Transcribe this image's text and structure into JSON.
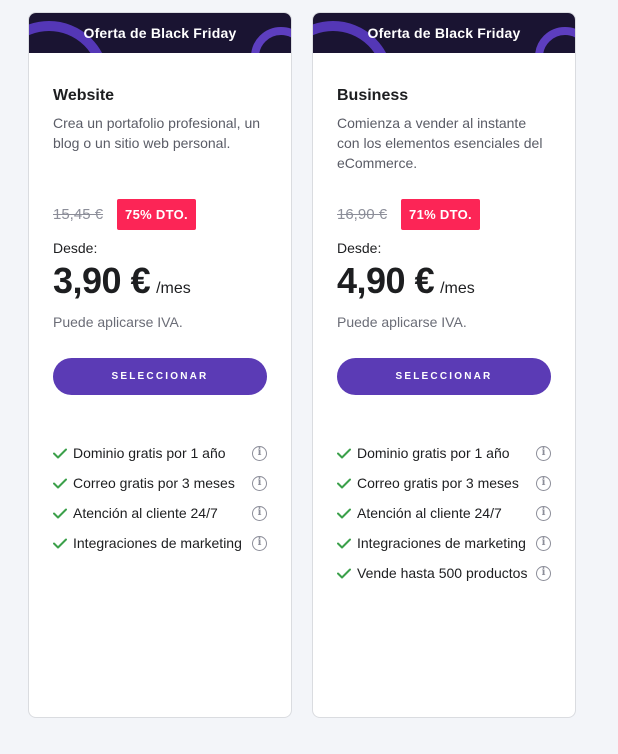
{
  "colors": {
    "accent": "#5b3bb5",
    "discount": "#fc2556",
    "banner_bg": "#1a1432",
    "check": "#3ca04b"
  },
  "plans": [
    {
      "banner": "Oferta de Black Friday",
      "name": "Website",
      "description": "Crea un portafolio profesional, un blog o un sitio web personal.",
      "old_price": "15,45 €",
      "discount": "75% DTO.",
      "from_label": "Desde:",
      "price": "3,90 €",
      "period": "/mes",
      "vat_note": "Puede aplicarse IVA.",
      "button": "SELECCIONAR",
      "features": [
        "Dominio gratis por 1 año",
        "Correo gratis por 3 meses",
        "Atención al cliente 24/7",
        "Integraciones de marketing"
      ]
    },
    {
      "banner": "Oferta de Black Friday",
      "name": "Business",
      "description": "Comienza a vender al instante con los elementos esenciales del eCommerce.",
      "old_price": "16,90 €",
      "discount": "71% DTO.",
      "from_label": "Desde:",
      "price": "4,90 €",
      "period": "/mes",
      "vat_note": "Puede aplicarse IVA.",
      "button": "SELECCIONAR",
      "features": [
        "Dominio gratis por 1 año",
        "Correo gratis por 3 meses",
        "Atención al cliente 24/7",
        "Integraciones de marketing",
        "Vende hasta 500 productos"
      ]
    }
  ],
  "icons": {
    "check": "check-icon",
    "info": "info-icon"
  }
}
